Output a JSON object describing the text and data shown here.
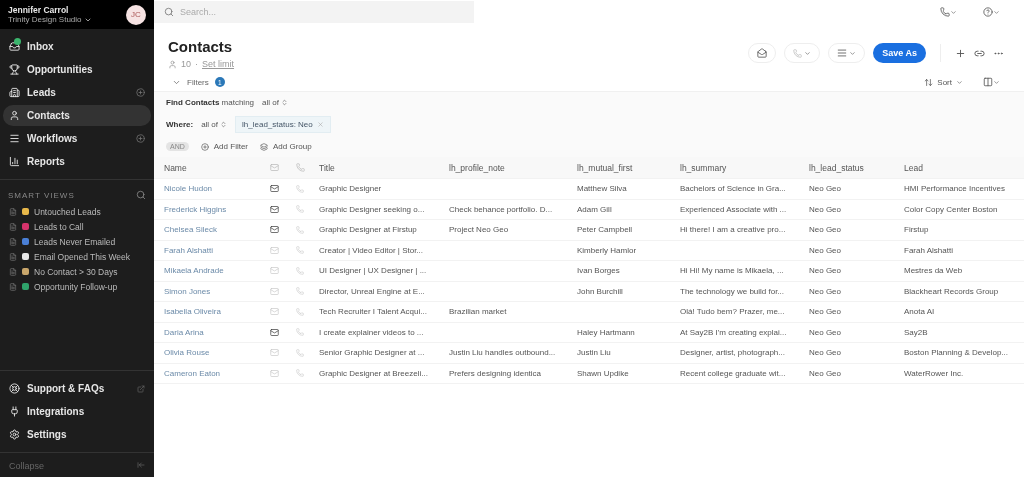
{
  "account": {
    "name": "Jennifer Carrol",
    "org": "Trinity Design Studio",
    "initials": "JC"
  },
  "nav": [
    {
      "label": "Inbox",
      "selected": false,
      "add": false
    },
    {
      "label": "Opportunities",
      "selected": false,
      "add": false
    },
    {
      "label": "Leads",
      "selected": false,
      "add": true
    },
    {
      "label": "Contacts",
      "selected": true,
      "add": false
    },
    {
      "label": "Workflows",
      "selected": false,
      "add": true
    },
    {
      "label": "Reports",
      "selected": false,
      "add": false
    }
  ],
  "smart_views": {
    "heading": "SMART VIEWS",
    "items": [
      {
        "label": "Untouched Leads",
        "color": "#e8b84a"
      },
      {
        "label": "Leads to Call",
        "color": "#d6336c"
      },
      {
        "label": "Leads Never Emailed",
        "color": "#4a7fd6"
      },
      {
        "label": "Email Opened This Week",
        "color": "#e6e6e6"
      },
      {
        "label": "No Contact > 30 Days",
        "color": "#c9a66b"
      },
      {
        "label": "Opportunity Follow-up",
        "color": "#2fa36b"
      }
    ]
  },
  "bottom_nav": [
    {
      "label": "Support & FAQs",
      "external": true
    },
    {
      "label": "Integrations",
      "external": false
    },
    {
      "label": "Settings",
      "external": false
    }
  ],
  "collapse": "Collapse",
  "search": {
    "placeholder": "Search..."
  },
  "page": {
    "title": "Contacts",
    "count": "10",
    "separator": "·",
    "limit_link": "Set limit"
  },
  "save_button": "Save As",
  "filters": {
    "label": "Filters",
    "count": "1",
    "sort": "Sort",
    "find_prefix": "Find Contacts",
    "find_matching": "matching",
    "find_mode": "all of",
    "where": "Where:",
    "where_mode": "all of",
    "chip": "lh_lead_status: Neo",
    "and": "AND",
    "add_filter": "Add Filter",
    "add_group": "Add Group"
  },
  "table": {
    "columns": [
      "Name",
      "Title",
      "lh_profile_note",
      "lh_mutual_first",
      "lh_summary",
      "lh_lead_status",
      "Lead"
    ],
    "rows": [
      {
        "name": "Nicole Hudon",
        "email_active": true,
        "title": "Graphic Designer",
        "note": "",
        "mutual": "Matthew Silva",
        "summary": "Bachelors of Science in Gra...",
        "status": "Neo Geo",
        "lead": "HMI Performance Incentives"
      },
      {
        "name": "Frederick Higgins",
        "email_active": true,
        "title": "Graphic Designer seeking o...",
        "note": "Check behance portfolio. D...",
        "mutual": "Adam Gill",
        "summary": "Experienced Associate with ...",
        "status": "Neo Geo",
        "lead": "Color Copy Center Boston"
      },
      {
        "name": "Chelsea Sileck",
        "email_active": true,
        "title": "Graphic Designer at Firstup",
        "note": "Project Neo Geo",
        "mutual": "Peter Campbell",
        "summary": "Hi there! I am a creative pro...",
        "status": "Neo Geo",
        "lead": "Firstup"
      },
      {
        "name": "Farah Alshatti",
        "email_active": false,
        "title": "Creator | Video Editor | Stor...",
        "note": "",
        "mutual": "Kimberly Hamlor",
        "summary": "",
        "status": "Neo Geo",
        "lead": "Farah Alshatti"
      },
      {
        "name": "Mikaela Andrade",
        "email_active": false,
        "title": "UI Designer | UX Designer | ...",
        "note": "",
        "mutual": "Ivan Borges",
        "summary": "Hi Hi! My name is Mikaela, ...",
        "status": "Neo Geo",
        "lead": "Mestres da Web"
      },
      {
        "name": "Simon Jones",
        "email_active": false,
        "title": "Director, Unreal Engine at E...",
        "note": "",
        "mutual": "John Burchill",
        "summary": "The technology we build for...",
        "status": "Neo Geo",
        "lead": "Blackheart Records Group"
      },
      {
        "name": "Isabella Oliveira",
        "email_active": false,
        "title": "Tech Recruiter I Talent Acqui...",
        "note": "Brazilian market",
        "mutual": "",
        "summary": "Olá! Tudo bem? Prazer, me...",
        "status": "Neo Geo",
        "lead": "Anota AI"
      },
      {
        "name": "Daria Arina",
        "email_active": true,
        "title": "I create explainer videos to ...",
        "note": "",
        "mutual": "Haley Hartmann",
        "summary": "At Say2B I'm creating explai...",
        "status": "Neo Geo",
        "lead": "Say2B"
      },
      {
        "name": "Olivia Rouse",
        "email_active": false,
        "title": "Senior Graphic Designer at ...",
        "note": "Justin Liu handles outbound...",
        "mutual": "Justin Liu",
        "summary": "Designer, artist, photograph...",
        "status": "Neo Geo",
        "lead": "Boston Planning & Develop..."
      },
      {
        "name": "Cameron Eaton",
        "email_active": false,
        "title": "Graphic Designer at Breezeli...",
        "note": "Prefers designing identica",
        "mutual": "Shawn Updike",
        "summary": "Recent college graduate wit...",
        "status": "Neo Geo",
        "lead": "WaterRower Inc."
      }
    ]
  }
}
